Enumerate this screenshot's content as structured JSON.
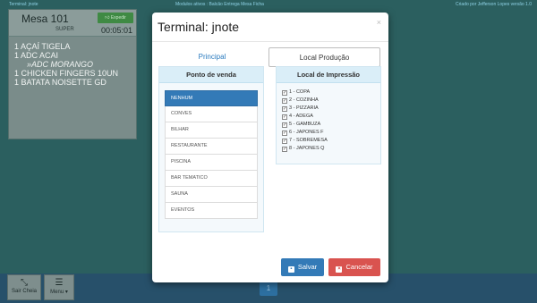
{
  "topbar": {
    "left": "Terminal: jnote",
    "center": "Modulos ativos : Balcão Entrega Mesa Ficha",
    "right": "Criado por Jefferson Lopes versão 1.0"
  },
  "order": {
    "title": "Mesa 101",
    "subtitle": "SUPER",
    "expedir_label": "Expedir",
    "time": "00:05:01",
    "items": [
      "1 AÇAÍ TIGELA",
      "1 ADC ACAI",
      "»ADC MORANGO",
      "1 CHICKEN FINGERS 10UN",
      "1 BATATA NOISETTE GD"
    ]
  },
  "bottom": {
    "sair_label": "Sair Cheia",
    "menu_label": "Menu",
    "page": "1"
  },
  "modal": {
    "title": "Terminal: jnote",
    "close": "×",
    "tabs": {
      "principal": "Principal",
      "local": "Local Produção"
    },
    "ponto_venda": {
      "header": "Ponto de venda",
      "items": [
        "NENHUM",
        "CONVES",
        "BILHAR",
        "RESTAURANTE",
        "PISCINA",
        "BAR TEMATICO",
        "SAUNA",
        "EVENTOS"
      ]
    },
    "local_impressao": {
      "header": "Local de Impressão",
      "items": [
        "1 - COPA",
        "2 - COZINHA",
        "3 - PIZZARIA",
        "4 - ADEGA",
        "5 - GAMBUZA",
        "6 - JAPONES F",
        "7 - SOBREMESA",
        "8 - JAPONES Q"
      ]
    },
    "salvar_label": "Salvar",
    "cancelar_label": "Cancelar"
  },
  "colors": {
    "primary": "#337ab7",
    "danger": "#d9534f",
    "panel_head": "#daeef8"
  }
}
